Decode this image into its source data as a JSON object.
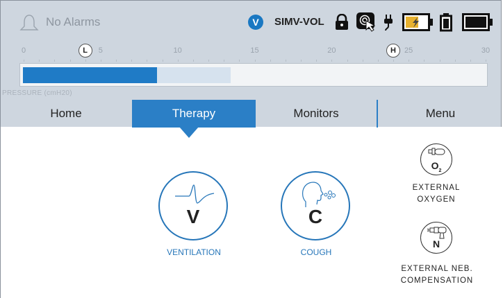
{
  "status": {
    "alarm_text": "No Alarms",
    "mode_badge": "V",
    "mode_text": "SIMV-VOL",
    "icons": [
      "bell-icon",
      "lock-icon",
      "touch-lock-icon",
      "ac-plug-icon",
      "charging-battery-icon",
      "internal-battery-icon",
      "battery-full-icon"
    ]
  },
  "pressure": {
    "label": "PRESSURE (cmH20)",
    "scale_min": 0,
    "scale_max": 30,
    "ticks": [
      "0",
      "5",
      "10",
      "15",
      "20",
      "25",
      "30"
    ],
    "low_marker": "L",
    "high_marker": "H",
    "low_value": 4,
    "high_value": 24,
    "current_value": 8.7,
    "range_end": 13.5
  },
  "tabs": [
    {
      "label": "Home"
    },
    {
      "label": "Therapy"
    },
    {
      "label": "Monitors"
    },
    {
      "label": "Menu"
    }
  ],
  "therapy": {
    "ventilation": {
      "letter": "V",
      "caption": "VENTILATION"
    },
    "cough": {
      "letter": "C",
      "caption": "COUGH"
    },
    "oxygen": {
      "letter": "O",
      "subscript": "2",
      "caption_line1": "EXTERNAL",
      "caption_line2": "OXYGEN"
    },
    "neb": {
      "letter": "N",
      "caption_line1": "EXTERNAL NEB.",
      "caption_line2": "COMPENSATION"
    }
  },
  "colors": {
    "accent": "#2b7fc6",
    "bar": "#1f7bc6",
    "header_bg": "#ced6df"
  }
}
